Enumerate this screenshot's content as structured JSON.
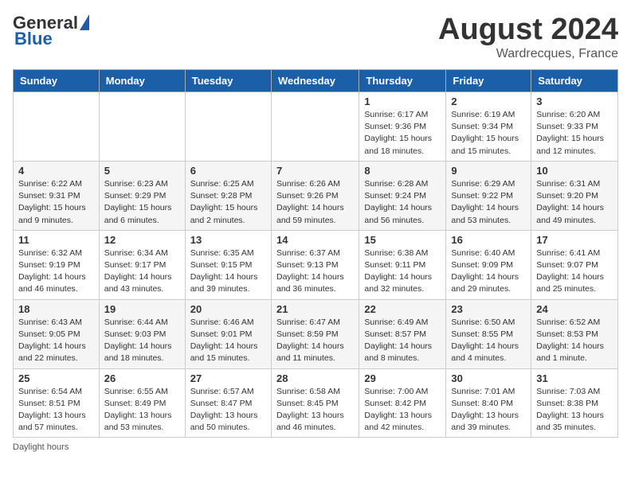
{
  "header": {
    "logo_general": "General",
    "logo_blue": "Blue",
    "month_year": "August 2024",
    "location": "Wardrecques, France"
  },
  "weekdays": [
    "Sunday",
    "Monday",
    "Tuesday",
    "Wednesday",
    "Thursday",
    "Friday",
    "Saturday"
  ],
  "weeks": [
    [
      {
        "day": "",
        "info": ""
      },
      {
        "day": "",
        "info": ""
      },
      {
        "day": "",
        "info": ""
      },
      {
        "day": "",
        "info": ""
      },
      {
        "day": "1",
        "info": "Sunrise: 6:17 AM\nSunset: 9:36 PM\nDaylight: 15 hours\nand 18 minutes."
      },
      {
        "day": "2",
        "info": "Sunrise: 6:19 AM\nSunset: 9:34 PM\nDaylight: 15 hours\nand 15 minutes."
      },
      {
        "day": "3",
        "info": "Sunrise: 6:20 AM\nSunset: 9:33 PM\nDaylight: 15 hours\nand 12 minutes."
      }
    ],
    [
      {
        "day": "4",
        "info": "Sunrise: 6:22 AM\nSunset: 9:31 PM\nDaylight: 15 hours\nand 9 minutes."
      },
      {
        "day": "5",
        "info": "Sunrise: 6:23 AM\nSunset: 9:29 PM\nDaylight: 15 hours\nand 6 minutes."
      },
      {
        "day": "6",
        "info": "Sunrise: 6:25 AM\nSunset: 9:28 PM\nDaylight: 15 hours\nand 2 minutes."
      },
      {
        "day": "7",
        "info": "Sunrise: 6:26 AM\nSunset: 9:26 PM\nDaylight: 14 hours\nand 59 minutes."
      },
      {
        "day": "8",
        "info": "Sunrise: 6:28 AM\nSunset: 9:24 PM\nDaylight: 14 hours\nand 56 minutes."
      },
      {
        "day": "9",
        "info": "Sunrise: 6:29 AM\nSunset: 9:22 PM\nDaylight: 14 hours\nand 53 minutes."
      },
      {
        "day": "10",
        "info": "Sunrise: 6:31 AM\nSunset: 9:20 PM\nDaylight: 14 hours\nand 49 minutes."
      }
    ],
    [
      {
        "day": "11",
        "info": "Sunrise: 6:32 AM\nSunset: 9:19 PM\nDaylight: 14 hours\nand 46 minutes."
      },
      {
        "day": "12",
        "info": "Sunrise: 6:34 AM\nSunset: 9:17 PM\nDaylight: 14 hours\nand 43 minutes."
      },
      {
        "day": "13",
        "info": "Sunrise: 6:35 AM\nSunset: 9:15 PM\nDaylight: 14 hours\nand 39 minutes."
      },
      {
        "day": "14",
        "info": "Sunrise: 6:37 AM\nSunset: 9:13 PM\nDaylight: 14 hours\nand 36 minutes."
      },
      {
        "day": "15",
        "info": "Sunrise: 6:38 AM\nSunset: 9:11 PM\nDaylight: 14 hours\nand 32 minutes."
      },
      {
        "day": "16",
        "info": "Sunrise: 6:40 AM\nSunset: 9:09 PM\nDaylight: 14 hours\nand 29 minutes."
      },
      {
        "day": "17",
        "info": "Sunrise: 6:41 AM\nSunset: 9:07 PM\nDaylight: 14 hours\nand 25 minutes."
      }
    ],
    [
      {
        "day": "18",
        "info": "Sunrise: 6:43 AM\nSunset: 9:05 PM\nDaylight: 14 hours\nand 22 minutes."
      },
      {
        "day": "19",
        "info": "Sunrise: 6:44 AM\nSunset: 9:03 PM\nDaylight: 14 hours\nand 18 minutes."
      },
      {
        "day": "20",
        "info": "Sunrise: 6:46 AM\nSunset: 9:01 PM\nDaylight: 14 hours\nand 15 minutes."
      },
      {
        "day": "21",
        "info": "Sunrise: 6:47 AM\nSunset: 8:59 PM\nDaylight: 14 hours\nand 11 minutes."
      },
      {
        "day": "22",
        "info": "Sunrise: 6:49 AM\nSunset: 8:57 PM\nDaylight: 14 hours\nand 8 minutes."
      },
      {
        "day": "23",
        "info": "Sunrise: 6:50 AM\nSunset: 8:55 PM\nDaylight: 14 hours\nand 4 minutes."
      },
      {
        "day": "24",
        "info": "Sunrise: 6:52 AM\nSunset: 8:53 PM\nDaylight: 14 hours\nand 1 minute."
      }
    ],
    [
      {
        "day": "25",
        "info": "Sunrise: 6:54 AM\nSunset: 8:51 PM\nDaylight: 13 hours\nand 57 minutes."
      },
      {
        "day": "26",
        "info": "Sunrise: 6:55 AM\nSunset: 8:49 PM\nDaylight: 13 hours\nand 53 minutes."
      },
      {
        "day": "27",
        "info": "Sunrise: 6:57 AM\nSunset: 8:47 PM\nDaylight: 13 hours\nand 50 minutes."
      },
      {
        "day": "28",
        "info": "Sunrise: 6:58 AM\nSunset: 8:45 PM\nDaylight: 13 hours\nand 46 minutes."
      },
      {
        "day": "29",
        "info": "Sunrise: 7:00 AM\nSunset: 8:42 PM\nDaylight: 13 hours\nand 42 minutes."
      },
      {
        "day": "30",
        "info": "Sunrise: 7:01 AM\nSunset: 8:40 PM\nDaylight: 13 hours\nand 39 minutes."
      },
      {
        "day": "31",
        "info": "Sunrise: 7:03 AM\nSunset: 8:38 PM\nDaylight: 13 hours\nand 35 minutes."
      }
    ]
  ],
  "footer": "Daylight hours"
}
